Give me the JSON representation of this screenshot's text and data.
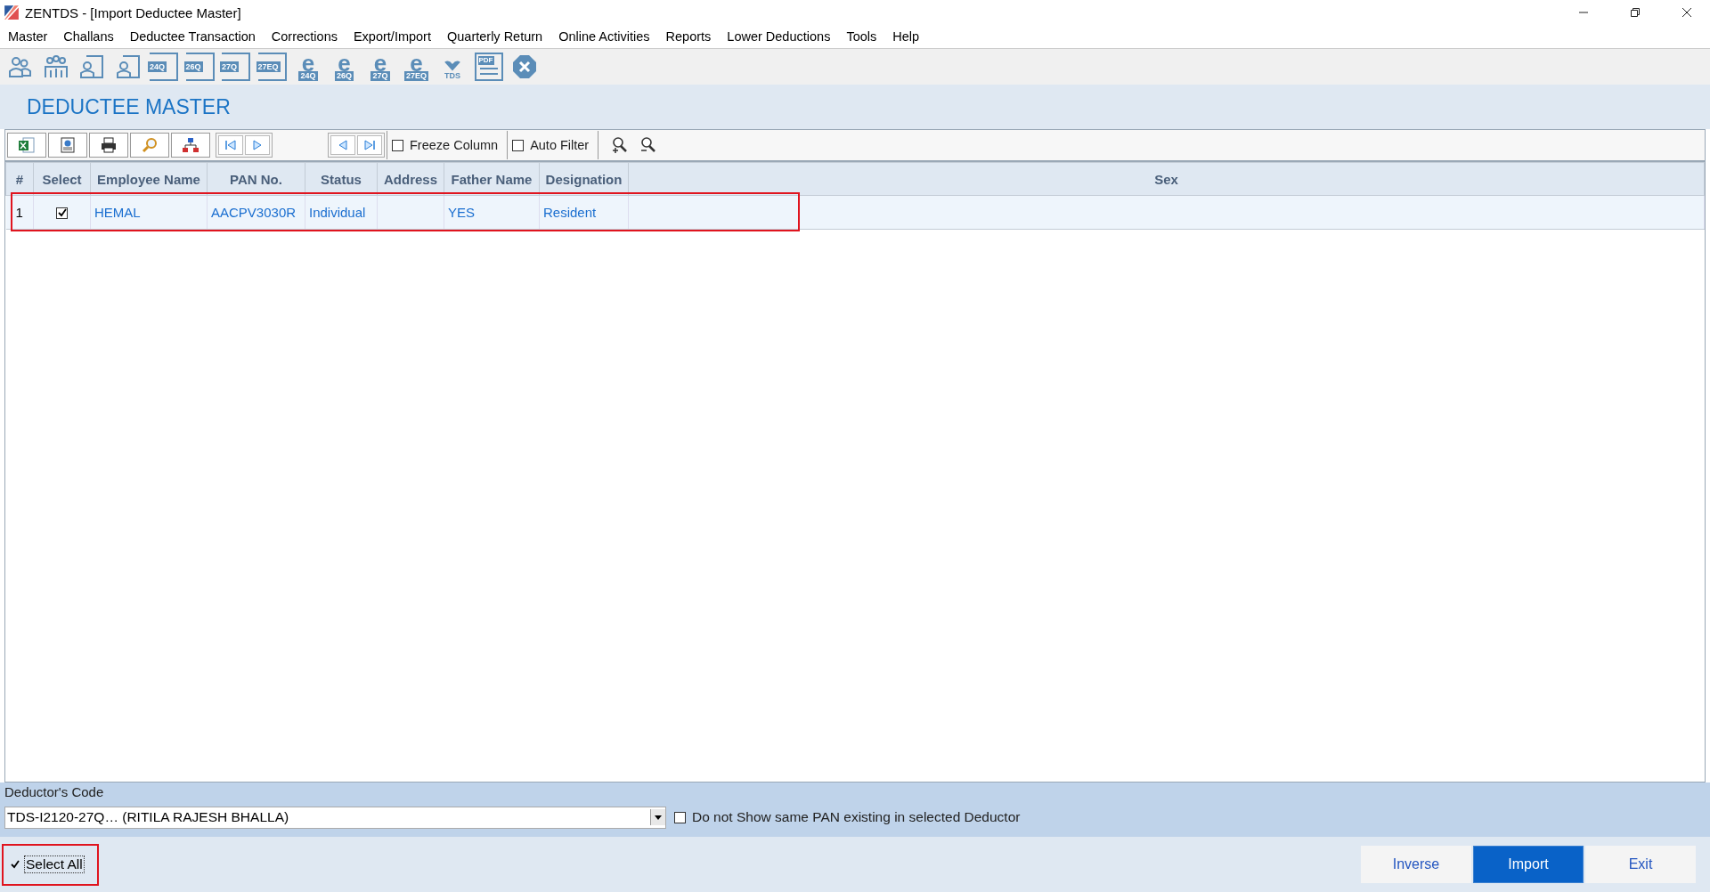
{
  "window": {
    "title": "ZENTDS - [Import Deductee Master]"
  },
  "menu": [
    "Master",
    "Challans",
    "Deductee Transaction",
    "Corrections",
    "Export/Import",
    "Quarterly Return",
    "Online Activities",
    "Reports",
    "Lower Deductions",
    "Tools",
    "Help"
  ],
  "toolbar": [
    {
      "kind": "person"
    },
    {
      "kind": "group"
    },
    {
      "kind": "person-doc"
    },
    {
      "kind": "person-doc"
    },
    {
      "kind": "doc",
      "label": "24Q"
    },
    {
      "kind": "doc",
      "label": "26Q"
    },
    {
      "kind": "doc",
      "label": "27Q"
    },
    {
      "kind": "doc",
      "label": "27EQ"
    },
    {
      "kind": "e",
      "label": "24Q"
    },
    {
      "kind": "e",
      "label": "26Q"
    },
    {
      "kind": "e",
      "label": "27Q"
    },
    {
      "kind": "e",
      "label": "27EQ"
    },
    {
      "kind": "tds",
      "label": "TDS"
    },
    {
      "kind": "pdf",
      "label": "PDF"
    },
    {
      "kind": "close"
    }
  ],
  "heading": "DEDUCTEE MASTER",
  "grid_toolbar": {
    "freeze_column": {
      "label": "Freeze Column",
      "checked": false
    },
    "auto_filter": {
      "label": "Auto Filter",
      "checked": false
    }
  },
  "table": {
    "columns": [
      "#",
      "Select",
      "Employee Name",
      "PAN No.",
      "Status",
      "Address",
      "Father Name",
      "Designation",
      "Sex"
    ],
    "rows": [
      {
        "checked": true,
        "highlighted": true,
        "cells": [
          "1",
          "",
          "HEMAL",
          "AACPV3030R",
          "Individual",
          "",
          "YES",
          "Resident",
          ""
        ]
      }
    ]
  },
  "deductor": {
    "label": "Deductor's Code",
    "value": "TDS-I2120-27Q… (RITILA RAJESH BHALLA)",
    "hide_same_pan": {
      "label": "Do not Show same PAN existing in selected Deductor",
      "checked": false
    }
  },
  "select_all": {
    "label": "Select All",
    "checked": true,
    "highlighted": true
  },
  "buttons": [
    {
      "label": "Inverse",
      "selected": false
    },
    {
      "label": "Import",
      "selected": true
    },
    {
      "label": "Exit",
      "selected": false
    }
  ]
}
